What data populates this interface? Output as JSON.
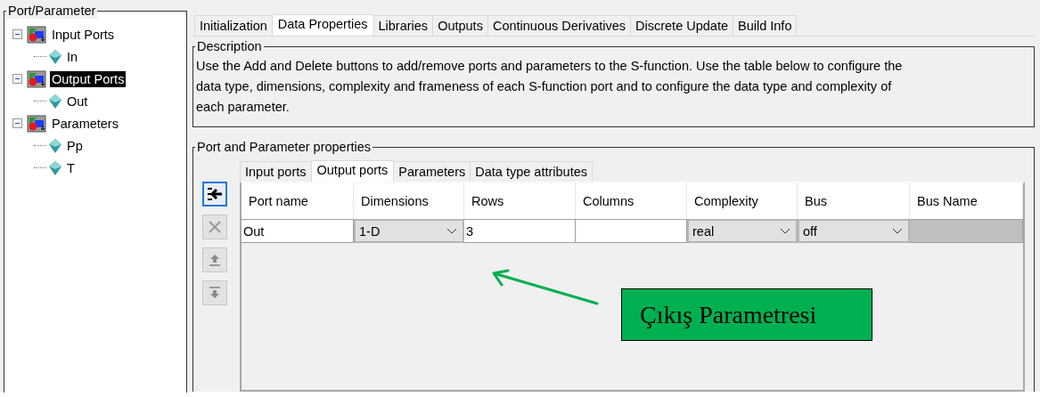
{
  "tree_panel": {
    "title": "Port/Parameter",
    "nodes": [
      {
        "label": "Input Ports",
        "selected": false,
        "expanded": true,
        "children": [
          {
            "label": "In",
            "selected": false
          }
        ]
      },
      {
        "label": "Output Ports",
        "selected": true,
        "expanded": true,
        "children": [
          {
            "label": "Out",
            "selected": false
          }
        ]
      },
      {
        "label": "Parameters",
        "selected": false,
        "expanded": true,
        "children": [
          {
            "label": "Pp",
            "selected": false
          },
          {
            "label": "T",
            "selected": false
          }
        ]
      }
    ]
  },
  "tabs": [
    {
      "label": "Initialization",
      "selected": false
    },
    {
      "label": "Data Properties",
      "selected": true
    },
    {
      "label": "Libraries",
      "selected": false
    },
    {
      "label": "Outputs",
      "selected": false
    },
    {
      "label": "Continuous Derivatives",
      "selected": false
    },
    {
      "label": "Discrete Update",
      "selected": false
    },
    {
      "label": "Build Info",
      "selected": false
    }
  ],
  "description": {
    "title": "Description",
    "text": "Use the Add and Delete buttons to add/remove ports and parameters to the S-function. Use the table below to configure the data type, dimensions, complexity and frameness of each S-function port and to configure the data type and complexity of each parameter."
  },
  "properties": {
    "title": "Port and Parameter properties",
    "tabs": [
      {
        "label": "Input ports",
        "selected": false
      },
      {
        "label": "Output ports",
        "selected": true
      },
      {
        "label": "Parameters",
        "selected": false
      },
      {
        "label": "Data type attributes",
        "selected": false
      }
    ],
    "tool_buttons": [
      {
        "kind": "add",
        "disabled": false,
        "focused": true
      },
      {
        "kind": "delete",
        "disabled": true,
        "focused": false
      },
      {
        "kind": "up",
        "disabled": true,
        "focused": false
      },
      {
        "kind": "down",
        "disabled": true,
        "focused": false
      }
    ],
    "table": {
      "columns": [
        "Port name",
        "Dimensions",
        "Rows",
        "Columns",
        "Complexity",
        "Bus",
        "Bus Name"
      ],
      "rows": [
        [
          {
            "kind": "text",
            "value": "Out"
          },
          {
            "kind": "dropdown",
            "value": "1-D"
          },
          {
            "kind": "text",
            "value": "3"
          },
          {
            "kind": "text"
          },
          {
            "kind": "dropdown",
            "value": "real"
          },
          {
            "kind": "dropdown",
            "value": "off"
          },
          {
            "kind": "readonly"
          }
        ]
      ]
    }
  },
  "annotation": {
    "text": "Çıkış Parametresi"
  }
}
